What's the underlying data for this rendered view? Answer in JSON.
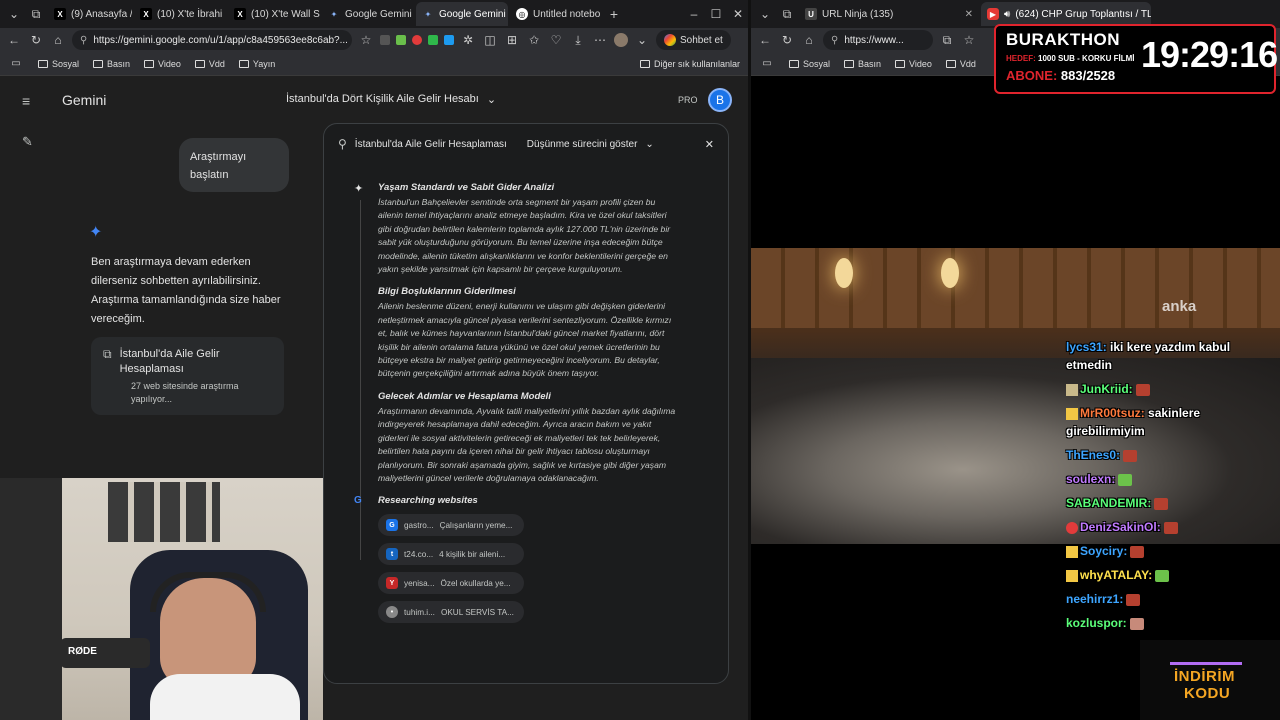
{
  "left_window": {
    "tabs": [
      {
        "label": "(9) Anasayfa / X",
        "icon": "x-icon"
      },
      {
        "label": "(10) X'te İbrahi",
        "icon": "x-icon"
      },
      {
        "label": "(10) X'te Wall S",
        "icon": "x-icon"
      },
      {
        "label": "Google Gemini",
        "icon": "gemini-icon"
      },
      {
        "label": "Google Gemini",
        "icon": "gemini-icon",
        "active": true
      },
      {
        "label": "Untitled notebo",
        "icon": "notebook-icon"
      }
    ],
    "url": "https://gemini.google.com/u/1/app/c8a459563ee8c6ab?...",
    "chat_button": "Sohbet et",
    "bookmarks": [
      "Sosyal",
      "Basın",
      "Video",
      "Vdd",
      "Yayın"
    ],
    "other_bookmarks": "Diğer sık kullanılanlar"
  },
  "gemini": {
    "brand": "Gemini",
    "conversation_title": "İstanbul'da Dört Kişilik Aile Gelir Hesabı",
    "pro_badge": "PRO",
    "avatar_letter": "B",
    "user_message": "Araştırmayı başlatın",
    "assistant_message": "Ben araştırmaya devam ederken dilerseniz sohbetten ayrılabilirsiniz. Araştırma tamamlandığında size haber vereceğim.",
    "research_card": {
      "title": "İstanbul'da Aile Gelir Hesaplaması",
      "status": "27 web sitesinde araştırma yapılıyor..."
    },
    "panel": {
      "title": "İstanbul'da Aile Gelir Hesaplaması",
      "thinking_toggle": "Düşünme sürecini göster",
      "sections": [
        {
          "title": "Yaşam Standardı ve Sabit Gider Analizi",
          "body": "İstanbul'un Bahçelievler semtinde orta segment bir yaşam profili çizen bu ailenin temel ihtiyaçlarını analiz etmeye başladım. Kira ve özel okul taksitleri gibi doğrudan belirtilen kalemlerin toplamda aylık 127.000 TL'nin üzerinde bir sabit yük oluşturduğunu görüyorum. Bu temel üzerine inşa edeceğim bütçe modelinde, ailenin tüketim alışkanlıklarını ve konfor beklentilerini gerçeğe en yakın şekilde yansıtmak için kapsamlı bir çerçeve kurguluyorum."
        },
        {
          "title": "Bilgi Boşluklarının Giderilmesi",
          "body": "Ailenin beslenme düzeni, enerji kullanımı ve ulaşım gibi değişken giderlerini netleştirmek amacıyla güncel piyasa verilerini sentezliyorum. Özellikle kırmızı et, balık ve kümes hayvanlarının İstanbul'daki güncel market fiyatlarını, dört kişilik bir ailenin ortalama fatura yükünü ve özel okul yemek ücretlerinin bu bütçeye ekstra bir maliyet getirip getirmeyeceğini inceliyorum. Bu detaylar, bütçenin gerçekçiliğini artırmak adına büyük önem taşıyor."
        },
        {
          "title": "Gelecek Adımlar ve Hesaplama Modeli",
          "body": "Araştırmanın devamında, Ayvalık tatili maliyetlerini yıllık bazdan aylık dağılıma indirgeyerek hesaplamaya dahil edeceğim. Ayrıca aracın bakım ve yakıt giderleri ile sosyal aktivitelerin getireceği ek maliyetleri tek tek belirleyerek, belirtilen hata payını da içeren nihai bir gelir ihtiyacı tablosu oluşturmayı planlıyorum. Bir sonraki aşamada giyim, sağlık ve kırtasiye gibi diğer yaşam maliyetlerini güncel verilerle doğrulamaya odaklanacağım."
        }
      ],
      "researching_label": "Researching websites",
      "sites": [
        {
          "domain": "gastro...",
          "title": "Çalışanların yeme..."
        },
        {
          "domain": "t24.co...",
          "title": "4 kişilik bir aileni..."
        },
        {
          "domain": "yenisa...",
          "title": "Özel okullarda ye..."
        },
        {
          "domain": "tuhim.i...",
          "title": "OKUL SERVİS TA..."
        }
      ]
    }
  },
  "right_window": {
    "tabs": [
      {
        "label": "URL Ninja (135)",
        "icon": "url-ninja-icon"
      },
      {
        "label": "(624) CHP Grup Toplantısı / TL",
        "icon": "youtube-icon",
        "active": true
      }
    ],
    "url": "https://www...",
    "bookmarks": [
      "Sosyal",
      "Basın",
      "Video",
      "Vdd"
    ]
  },
  "overlay": {
    "channel": "BURAKTHON",
    "goal_label": "HEDEF:",
    "goal_text": "1000 SUB - KORKU FİLMİ",
    "subs_label": "ABONE:",
    "subs_value": "883/2528",
    "clock": "19:29:16",
    "video_watermark": "anka",
    "promo_line1": "İNDİRİM",
    "promo_line2": "KODU"
  },
  "chat": [
    {
      "user": "lycs31",
      "message": "iki kere yazdım kabul etmedin",
      "color": "#3da5ff"
    },
    {
      "user": "JunKriid",
      "message": "",
      "color": "#5bff7a"
    },
    {
      "user": "MrR00tsuz",
      "message": "sakinlere girebilirmiyim",
      "color": "#ff7a3d"
    },
    {
      "user": "ThEnes0",
      "message": "",
      "color": "#3da5ff"
    },
    {
      "user": "soulexn",
      "message": "",
      "color": "#c17bff"
    },
    {
      "user": "SABANDEMIR",
      "message": "",
      "color": "#5bff7a"
    },
    {
      "user": "DenizSakinOl",
      "message": "",
      "color": "#c17bff"
    },
    {
      "user": "Soyciry",
      "message": "",
      "color": "#3da5ff"
    },
    {
      "user": "whyATALAY",
      "message": "",
      "color": "#ffe14d"
    },
    {
      "user": "neehirrz1",
      "message": "",
      "color": "#3da5ff"
    },
    {
      "user": "kozluspor",
      "message": "",
      "color": "#5bff7a"
    }
  ]
}
